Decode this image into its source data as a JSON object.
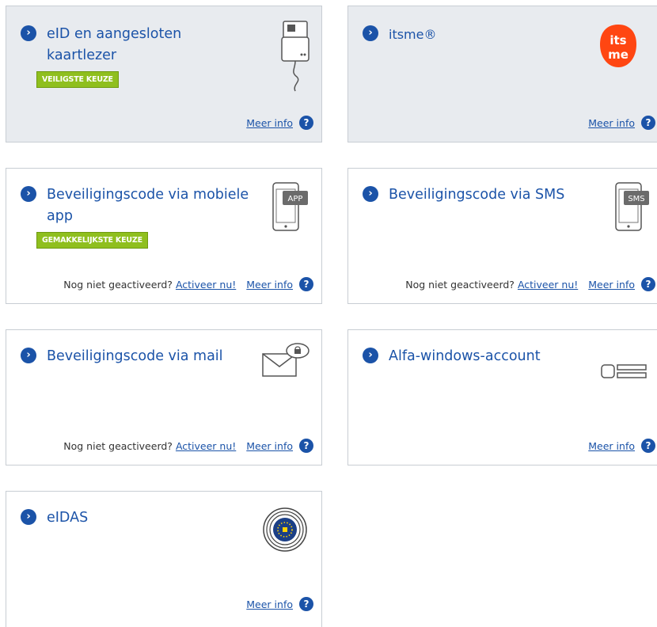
{
  "cards": [
    {
      "title": "eID en aangesloten kaartlezer",
      "badge": "VEILIGSTE KEUZE",
      "icon": "card-reader-icon",
      "meer_info": "Meer info"
    },
    {
      "title": "itsme®",
      "icon": "itsme-logo",
      "logo_text_top": "its",
      "logo_text_bottom": "me",
      "meer_info": "Meer info"
    },
    {
      "title": "Beveiligingscode via mobiele app",
      "badge": "GEMAKKELIJKSTE KEUZE",
      "icon": "mobile-app-icon",
      "icon_label": "APP",
      "not_activated": "Nog niet geactiveerd?",
      "activate": "Activeer nu!",
      "meer_info": "Meer info"
    },
    {
      "title": "Beveiligingscode via SMS",
      "icon": "sms-phone-icon",
      "icon_label": "SMS",
      "not_activated": "Nog niet geactiveerd?",
      "activate": "Activeer nu!",
      "meer_info": "Meer info"
    },
    {
      "title": "Beveiligingscode via mail",
      "icon": "mail-icon",
      "not_activated": "Nog niet geactiveerd?",
      "activate": "Activeer nu!",
      "meer_info": "Meer info"
    },
    {
      "title": "Alfa-windows-account",
      "icon": "account-icon",
      "meer_info": "Meer info"
    },
    {
      "title": "eIDAS",
      "icon": "eidas-icon",
      "meer_info": "Meer info"
    }
  ],
  "colors": {
    "accent": "#1b53a8",
    "badge": "#8fbf1e",
    "itsme": "#ff4612",
    "selected_bg": "#e8ebef"
  }
}
